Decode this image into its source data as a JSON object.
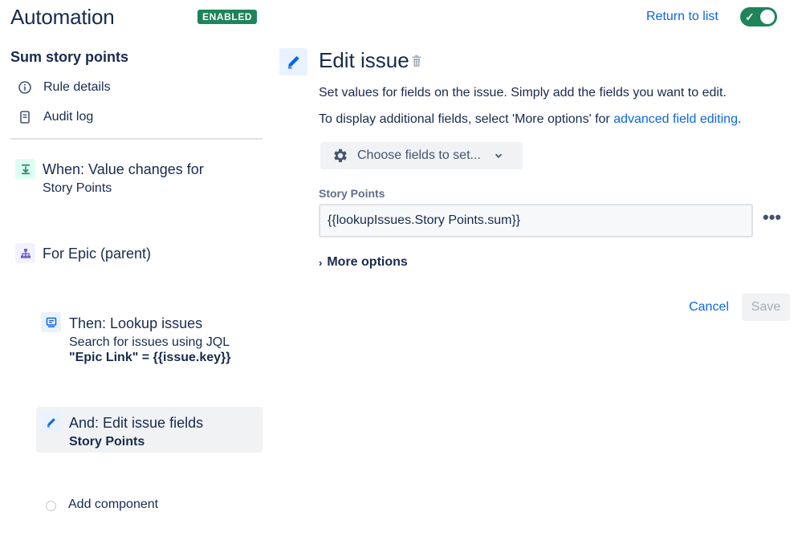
{
  "header": {
    "app_title": "Automation",
    "status_badge": "ENABLED",
    "return_link": "Return to list"
  },
  "sidebar": {
    "rule_name": "Sum story points",
    "links": [
      {
        "label": "Rule details",
        "icon": "info-icon"
      },
      {
        "label": "Audit log",
        "icon": "document-icon"
      }
    ],
    "components": [
      {
        "title": "When: Value changes for",
        "sub": "Story Points",
        "icon": "trigger-icon"
      },
      {
        "title": "For Epic (parent)",
        "icon": "hierarchy-icon"
      },
      {
        "title": "Then: Lookup issues",
        "sub": "Search for issues using JQL",
        "sub_bold": "\"Epic Link\" = {{issue.key}}",
        "icon": "lookup-icon"
      },
      {
        "title": "And: Edit issue fields",
        "sub_bold": "Story Points",
        "icon": "edit-icon",
        "selected": true
      }
    ],
    "add_component": "Add component"
  },
  "main": {
    "title": "Edit issue",
    "description_1": "Set values for fields on the issue. Simply add the fields you want to edit.",
    "description_2_prefix": "To display additional fields, select 'More options' for ",
    "description_2_link": "advanced field editing",
    "description_2_suffix": ".",
    "choose_fields_label": "Choose fields to set...",
    "field": {
      "label": "Story Points",
      "value": "{{lookupIssues.Story Points.sum}}"
    },
    "more_dots": "•••",
    "more_options": "More options",
    "cancel_label": "Cancel",
    "save_label": "Save"
  },
  "colors": {
    "primary_text": "#172b4d",
    "link": "#0c66e4",
    "enabled_green": "#1f845a",
    "selected_bg": "#f1f2f4"
  }
}
